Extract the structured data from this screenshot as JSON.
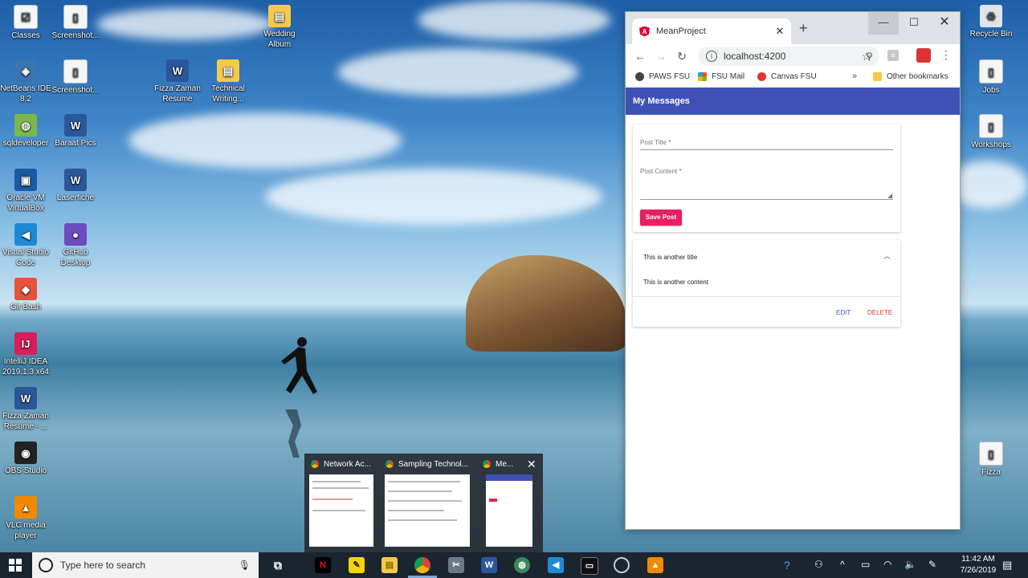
{
  "desktop": {
    "icons_left": [
      {
        "label": "Classes",
        "icon": "file-icon",
        "glyph": "☑"
      },
      {
        "label": "Screenshot...",
        "icon": "file-icon",
        "glyph": "▯"
      },
      {
        "label": "NetBeans IDE 8.2",
        "icon": "netbeans-icon",
        "glyph": "◈"
      },
      {
        "label": "Screenshot...",
        "icon": "file-icon",
        "glyph": "▯"
      },
      {
        "label": "sqldeveloper",
        "icon": "sqldeveloper-icon",
        "glyph": "◍"
      },
      {
        "label": "Baraat Pics",
        "icon": "word-icon",
        "glyph": "W"
      },
      {
        "label": "Oracle VM VirtualBox",
        "icon": "virtualbox-icon",
        "glyph": "▣"
      },
      {
        "label": "Laserfiche",
        "icon": "word-icon",
        "glyph": "W"
      },
      {
        "label": "Visual Studio Code",
        "icon": "vscode-icon",
        "glyph": "◀"
      },
      {
        "label": "GitHub Desktop",
        "icon": "github-icon",
        "glyph": "●"
      },
      {
        "label": "Git Bash",
        "icon": "git-icon",
        "glyph": "◆"
      },
      {
        "label": "IntelliJ IDEA 2019.1.3 x64",
        "icon": "intellij-icon",
        "glyph": "IJ"
      },
      {
        "label": "Fizza Zaman Resume - ...",
        "icon": "word-icon",
        "glyph": "W"
      },
      {
        "label": "OBS Studio",
        "icon": "obs-icon",
        "glyph": "◉"
      },
      {
        "label": "VLC media player",
        "icon": "vlc-icon",
        "glyph": "▲"
      }
    ],
    "icons_middle": [
      {
        "label": "Fizza Zaman Resume",
        "icon": "word-icon",
        "glyph": "W"
      },
      {
        "label": "Technical Writing...",
        "icon": "folder-icon",
        "glyph": "▤"
      },
      {
        "label": "Wedding Album",
        "icon": "folder-icon",
        "glyph": "▤"
      }
    ],
    "icons_right": [
      {
        "label": "Recycle Bin",
        "icon": "recycle-bin-icon",
        "glyph": "♻"
      },
      {
        "label": "Jobs",
        "icon": "file-icon",
        "glyph": "▯"
      },
      {
        "label": "Workshops",
        "icon": "file-icon",
        "glyph": "▯"
      },
      {
        "label": "Fizza",
        "icon": "file-icon",
        "glyph": "▯"
      }
    ]
  },
  "browser": {
    "tab_title": "MeanProject",
    "tab_icon_letter": "A",
    "new_tab": "+",
    "url": "localhost:4200",
    "bookmarks": [
      {
        "label": "PAWS FSU",
        "color": "#444444"
      },
      {
        "label": "FSU Mail",
        "color": "#f25022"
      },
      {
        "label": "Canvas FSU",
        "color": "#e3342f"
      }
    ],
    "bookmarks_more": "»",
    "other_bookmarks": "Other bookmarks"
  },
  "app": {
    "header_title": "My Messages",
    "form": {
      "title_placeholder": "Post Title *",
      "content_placeholder": "Post Content *",
      "save_label": "Save Post"
    },
    "posts": [
      {
        "title": "This is another title",
        "content": "This is another content",
        "edit_label": "EDIT",
        "delete_label": "DELETE"
      }
    ]
  },
  "task_thumbnails": [
    {
      "title": "Network Ac..."
    },
    {
      "title": "Sampling Technol..."
    },
    {
      "title": "Me..."
    }
  ],
  "taskbar": {
    "search_placeholder": "Type here to search",
    "clock_time": "11:42 AM",
    "clock_date": "7/26/2019"
  },
  "colors": {
    "app_header": "#3f51b5",
    "save_button": "#e91e63",
    "delete": "#e53935",
    "taskbar": "#1a2530"
  }
}
